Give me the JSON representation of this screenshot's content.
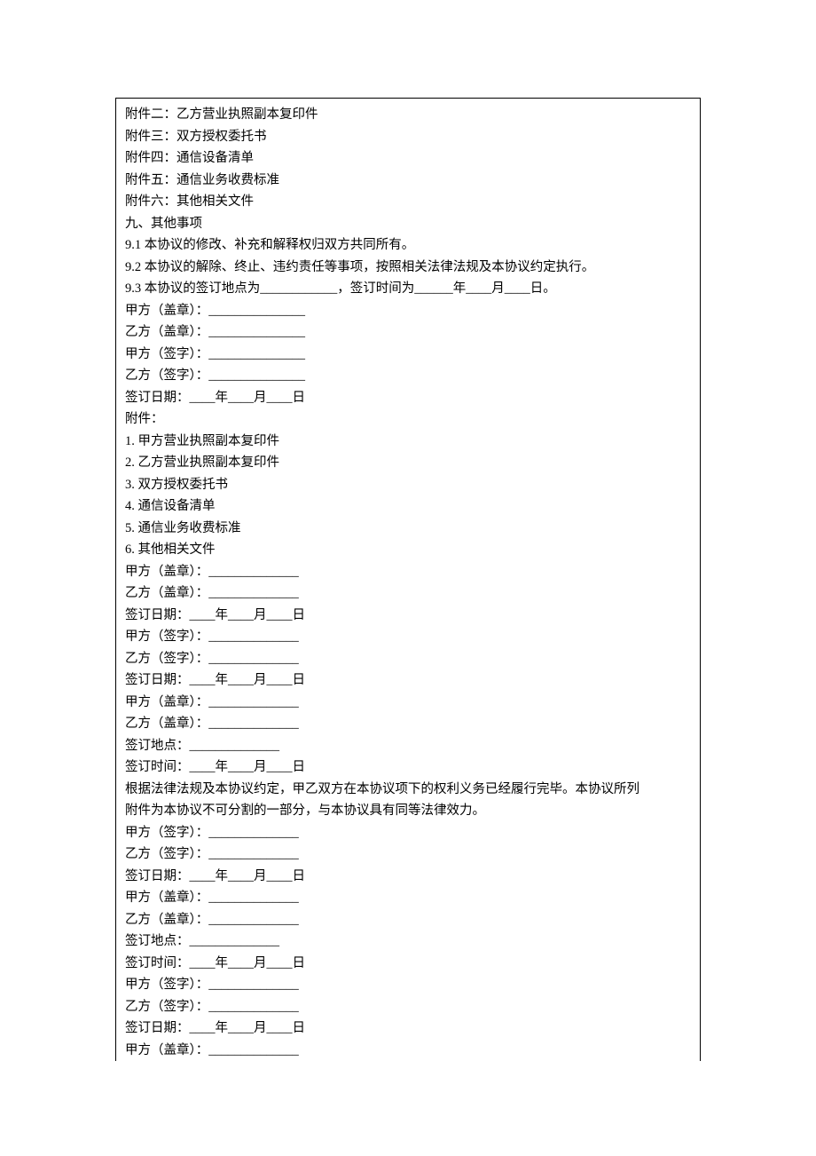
{
  "lines": [
    "附件二：乙方营业执照副本复印件",
    "附件三：双方授权委托书",
    "附件四：通信设备清单",
    "附件五：通信业务收费标准",
    "附件六：其他相关文件",
    "九、其他事项",
    "9.1 本协议的修改、补充和解释权归双方共同所有。",
    "9.2 本协议的解除、终止、违约责任等事项，按照相关法律法规及本协议约定执行。",
    "9.3 本协议的签订地点为____________，签订时间为______年____月____日。",
    "甲方（盖章）：_______________",
    "乙方（盖章）：_______________",
    "甲方（签字）：_______________",
    "乙方（签字）：_______________",
    "签订日期：____年____月____日",
    "附件：",
    "1. 甲方营业执照副本复印件",
    "2. 乙方营业执照副本复印件",
    "3. 双方授权委托书",
    "4. 通信设备清单",
    "5. 通信业务收费标准",
    "6. 其他相关文件",
    "甲方（盖章）：______________",
    "乙方（盖章）：______________",
    "签订日期：____年____月____日",
    "甲方（签字）：______________",
    "乙方（签字）：______________",
    "签订日期：____年____月____日",
    "甲方（盖章）：______________",
    "乙方（盖章）：______________",
    "签订地点：______________",
    "签订时间：____年____月____日",
    "根据法律法规及本协议约定，甲乙双方在本协议项下的权利义务已经履行完毕。本协议所列",
    "附件为本协议不可分割的一部分，与本协议具有同等法律效力。",
    "甲方（签字）：______________",
    "乙方（签字）：______________",
    "签订日期：____年____月____日",
    "甲方（盖章）：______________",
    "乙方（盖章）：______________",
    "签订地点：______________",
    "签订时间：____年____月____日",
    "甲方（签字）：______________",
    "乙方（签字）：______________",
    "签订日期：____年____月____日",
    "甲方（盖章）：______________"
  ]
}
